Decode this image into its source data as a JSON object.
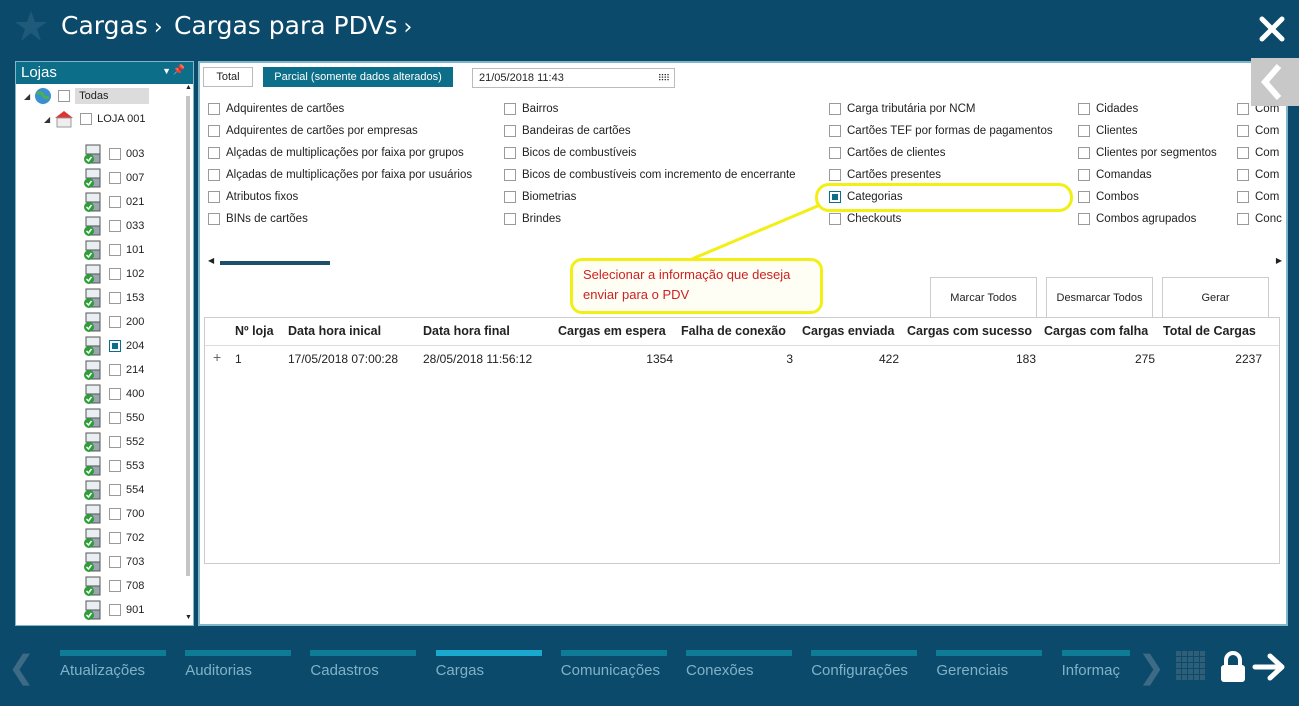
{
  "header": {
    "breadcrumb": [
      {
        "label": "Cargas"
      },
      {
        "label": "Cargas para PDVs"
      }
    ]
  },
  "lojas_panel": {
    "title": "Lojas",
    "root_label": "Todas",
    "store_label": "LOJA 001",
    "pdvs": [
      {
        "code": "003",
        "checked": false
      },
      {
        "code": "007",
        "checked": false
      },
      {
        "code": "021",
        "checked": false
      },
      {
        "code": "033",
        "checked": false
      },
      {
        "code": "101",
        "checked": false
      },
      {
        "code": "102",
        "checked": false
      },
      {
        "code": "153",
        "checked": false
      },
      {
        "code": "200",
        "checked": false
      },
      {
        "code": "204",
        "checked": true
      },
      {
        "code": "214",
        "checked": false
      },
      {
        "code": "400",
        "checked": false
      },
      {
        "code": "550",
        "checked": false
      },
      {
        "code": "552",
        "checked": false
      },
      {
        "code": "553",
        "checked": false
      },
      {
        "code": "554",
        "checked": false
      },
      {
        "code": "700",
        "checked": false
      },
      {
        "code": "702",
        "checked": false
      },
      {
        "code": "703",
        "checked": false
      },
      {
        "code": "708",
        "checked": false
      },
      {
        "code": "901",
        "checked": false
      }
    ]
  },
  "mode_tabs": {
    "total": "Total",
    "parcial": "Parcial (somente dados alterados)",
    "date": "21/05/2018 11:43"
  },
  "cargas_columns": [
    [
      {
        "label": "Adquirentes de cartões",
        "checked": false
      },
      {
        "label": "Adquirentes de cartões por empresas",
        "checked": false
      },
      {
        "label": "Alçadas de multiplicações por faixa por grupos",
        "checked": false
      },
      {
        "label": "Alçadas de multiplicações por faixa por usuários",
        "checked": false
      },
      {
        "label": "Atributos fixos",
        "checked": false
      },
      {
        "label": "BINs de cartões",
        "checked": false
      }
    ],
    [
      {
        "label": "Bairros",
        "checked": false
      },
      {
        "label": "Bandeiras de cartões",
        "checked": false
      },
      {
        "label": "Bicos de combustíveis",
        "checked": false
      },
      {
        "label": "Bicos de combustíveis com incremento de encerrante",
        "checked": false
      },
      {
        "label": "Biometrias",
        "checked": false
      },
      {
        "label": "Brindes",
        "checked": false
      }
    ],
    [
      {
        "label": "Carga tributária por NCM",
        "checked": false
      },
      {
        "label": "Cartões TEF por formas de pagamentos",
        "checked": false
      },
      {
        "label": "Cartões de clientes",
        "checked": false
      },
      {
        "label": "Cartões presentes",
        "checked": false
      },
      {
        "label": "Categorias",
        "checked": true
      },
      {
        "label": "Checkouts",
        "checked": false
      }
    ],
    [
      {
        "label": "Cidades",
        "checked": false
      },
      {
        "label": "Clientes",
        "checked": false
      },
      {
        "label": "Clientes por segmentos",
        "checked": false
      },
      {
        "label": "Comandas",
        "checked": false
      },
      {
        "label": "Combos",
        "checked": false
      },
      {
        "label": "Combos agrupados",
        "checked": false
      }
    ],
    [
      {
        "label": "Com",
        "checked": false
      },
      {
        "label": "Com",
        "checked": false
      },
      {
        "label": "Com",
        "checked": false
      },
      {
        "label": "Com",
        "checked": false
      },
      {
        "label": "Com",
        "checked": false
      },
      {
        "label": "Conc",
        "checked": false
      }
    ]
  ],
  "annotation": {
    "text": "Selecionar a informação que deseja enviar para o PDV"
  },
  "actions": {
    "marcar": "Marcar Todos",
    "desmarcar": "Desmarcar Todos",
    "gerar": "Gerar"
  },
  "table": {
    "headers": [
      "Nº loja",
      "Data hora inical",
      "Data hora final",
      "Cargas em espera",
      "Falha de conexão",
      "Cargas enviada",
      "Cargas com sucesso",
      "Cargas com falha",
      "Total de Cargas"
    ],
    "rows": [
      {
        "expand": "+",
        "loja": "1",
        "inicio": "17/05/2018 07:00:28",
        "fim": "28/05/2018 11:56:12",
        "espera": "1354",
        "falha_conexao": "3",
        "enviada": "422",
        "sucesso": "183",
        "falha": "275",
        "total": "2237"
      }
    ]
  },
  "modules": [
    "Atualizações",
    "Auditorias",
    "Cadastros",
    "Cargas",
    "Comunicações",
    "Conexões",
    "Configurações",
    "Gerenciais",
    "Informaç"
  ],
  "active_module": "Cargas",
  "colors": {
    "background": "#0c4a6b",
    "accent": "#0d6e8a",
    "active_module": "#19a9cf",
    "annotation_border": "#f2ef14",
    "annotation_text": "#cc2222"
  }
}
